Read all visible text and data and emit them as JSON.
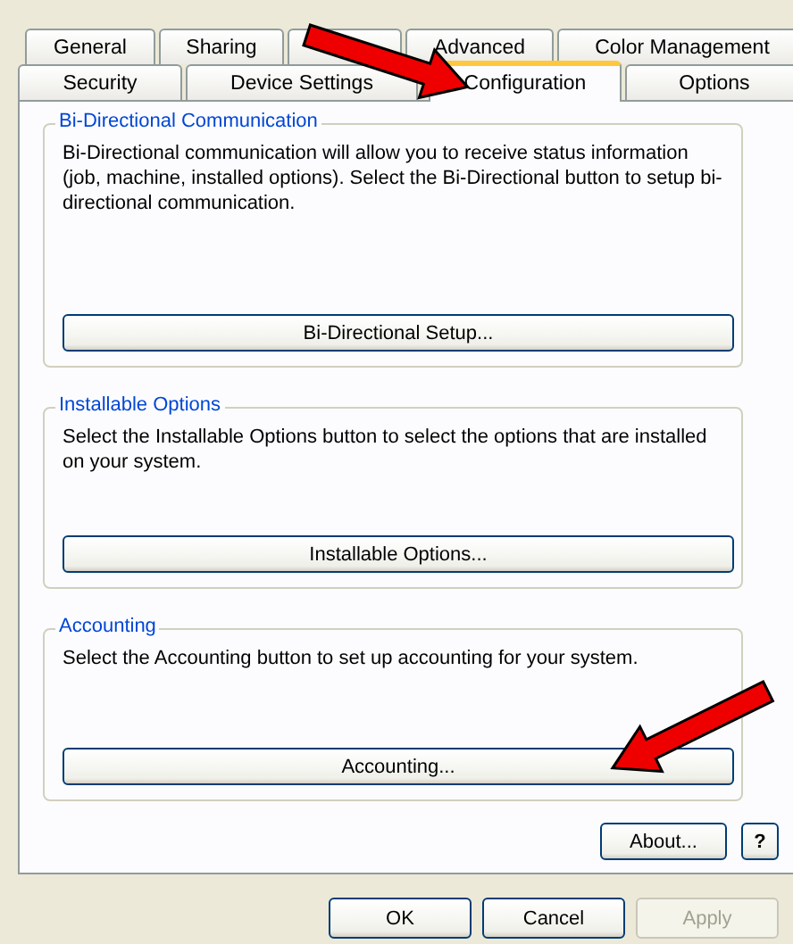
{
  "tabs_back_row": [
    {
      "label": "General",
      "selected": false
    },
    {
      "label": "Sharing",
      "selected": false
    },
    {
      "selected": false
    },
    {
      "label": "Advanced",
      "selected": false
    },
    {
      "label": "Color Management",
      "selected": false
    }
  ],
  "tabs_front_row": [
    {
      "label": "Security",
      "selected": false
    },
    {
      "label": "Device Settings",
      "selected": false
    },
    {
      "label": "Configuration",
      "selected": true
    },
    {
      "label": "Options",
      "selected": false
    }
  ],
  "groups": [
    {
      "title": "Bi-Directional Communication",
      "text": "Bi-Directional communication will allow you to receive status information (job, machine, installed options). Select the Bi-Directional button to setup bi-directional communication.",
      "button": "Bi-Directional Setup..."
    },
    {
      "title": "Installable Options",
      "text": "Select the Installable Options button to select the options that are installed on your system.",
      "button": "Installable Options..."
    },
    {
      "title": "Accounting",
      "text": "Select the Accounting button to set up accounting for your system.",
      "button": "Accounting..."
    }
  ],
  "about_button": "About...",
  "help_button": "?",
  "buttons": [
    {
      "label": "OK",
      "disabled": false
    },
    {
      "label": "Cancel",
      "disabled": false
    },
    {
      "label": "Apply",
      "disabled": true
    }
  ]
}
